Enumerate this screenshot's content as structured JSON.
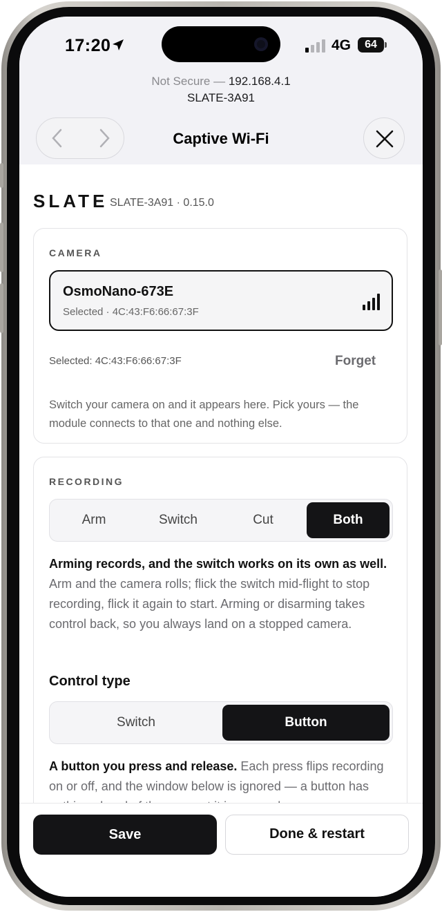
{
  "status": {
    "time": "17:20",
    "network": "4G",
    "battery": "64"
  },
  "browser": {
    "security_label": "Not Secure —",
    "host": "192.168.4.1",
    "page_title": "SLATE-3A91",
    "sheet_title": "Captive Wi-Fi"
  },
  "header": {
    "brand": "SLATE",
    "device_info": "SLATE-3A91 · 0.15.0"
  },
  "camera": {
    "section_title": "CAMERA",
    "item": {
      "name": "OsmoNano-673E",
      "detail": "Selected · 4C:43:F6:66:67:3F"
    },
    "selected_text": "Selected: 4C:43:F6:66:67:3F",
    "forget_label": "Forget",
    "help": "Switch your camera on and it appears here. Pick yours — the module connects to that one and nothing else."
  },
  "recording": {
    "section_title": "RECORDING",
    "modes": [
      "Arm",
      "Switch",
      "Cut",
      "Both"
    ],
    "active_mode": "Both",
    "mode_desc_bold": "Arming records, and the switch works on its own as well.",
    "mode_desc": " Arm and the camera rolls; flick the switch mid-flight to stop recording, flick it again to start. Arming or disarming takes control back, so you always land on a stopped camera.",
    "control_type_title": "Control type",
    "control_types": [
      "Switch",
      "Button"
    ],
    "active_control_type": "Button",
    "control_desc_bold": "A button you press and release.",
    "control_desc": " Each press flips recording on or off, and the window below is ignored — a button has nothing ahead of the moment it is pressed."
  },
  "actions": {
    "save_label": "Save",
    "done_label": "Done & restart"
  },
  "colors": {
    "accent": "#141416",
    "surface": "#f2f2f6",
    "muted": "#6b6b6f"
  }
}
